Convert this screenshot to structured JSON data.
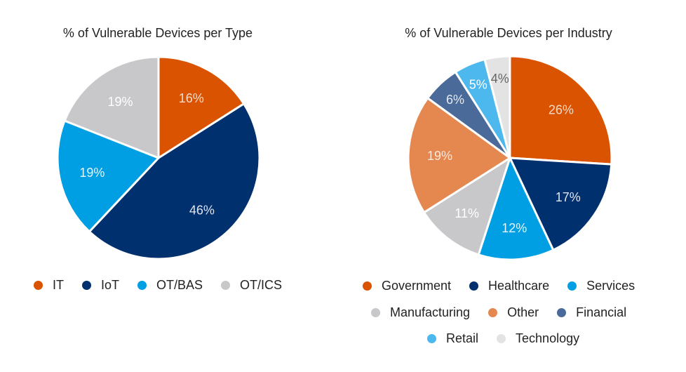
{
  "chart_data": [
    {
      "type": "pie",
      "title": "% of Vulnerable Devices per Type",
      "categories": [
        "IT",
        "IoT",
        "OT/BAS",
        "OT/ICS"
      ],
      "values": [
        16,
        46,
        19,
        19
      ],
      "labels": [
        "16%",
        "46%",
        "19%",
        "19%"
      ],
      "colors": [
        "#d95300",
        "#00306e",
        "#009fe3",
        "#c8c7c9"
      ],
      "label_colors": [
        "#f5dccb",
        "#e0e4ee",
        "#e6f4fb",
        "#ffffff"
      ],
      "legend_position": "bottom"
    },
    {
      "type": "pie",
      "title": "% of Vulnerable Devices per Industry",
      "categories": [
        "Government",
        "Healthcare",
        "Services",
        "Manufacturing",
        "Other",
        "Financial",
        "Retail",
        "Technology"
      ],
      "values": [
        26,
        17,
        12,
        11,
        19,
        6,
        5,
        4
      ],
      "labels": [
        "26%",
        "17%",
        "12%",
        "11%",
        "19%",
        "6%",
        "5%",
        "4%"
      ],
      "colors": [
        "#d95300",
        "#00306e",
        "#009fe3",
        "#c8c7c9",
        "#e5884f",
        "#4a6a9a",
        "#4db8ee",
        "#e3e3e3"
      ],
      "label_colors": [
        "#f5dccb",
        "#e0e4ee",
        "#e6f4fb",
        "#ffffff",
        "#fbe8dc",
        "#e6ebf2",
        "#ffffff",
        "#666666"
      ],
      "legend_position": "bottom"
    }
  ]
}
